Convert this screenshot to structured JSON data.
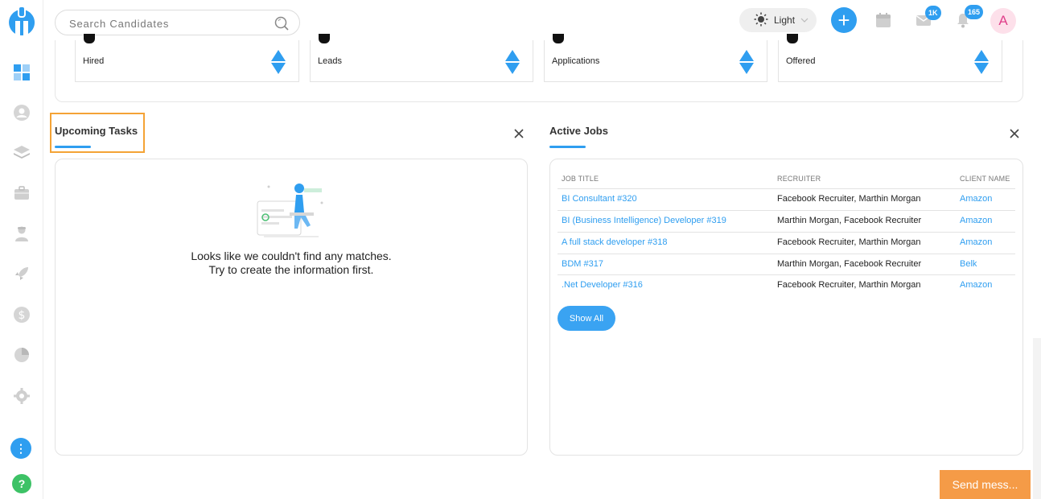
{
  "header": {
    "search_placeholder": "Search Candidates",
    "theme_label": "Light",
    "mail_badge": "1K",
    "notification_badge": "165",
    "avatar_initial": "A"
  },
  "stats": [
    {
      "label": "Hired"
    },
    {
      "label": "Leads"
    },
    {
      "label": "Applications"
    },
    {
      "label": "Offered"
    }
  ],
  "upcoming_tasks": {
    "title": "Upcoming Tasks",
    "empty_line1": "Looks like we couldn't find any matches.",
    "empty_line2": "Try to create the information first."
  },
  "active_jobs": {
    "title": "Active Jobs",
    "columns": [
      "JOB TITLE",
      "RECRUITER",
      "CLIENT NAME"
    ],
    "rows": [
      {
        "title": "BI Consultant #320",
        "recruiter": "Facebook Recruiter, Marthin Morgan",
        "client": "Amazon"
      },
      {
        "title": "BI (Business Intelligence) Developer #319",
        "recruiter": "Marthin Morgan, Facebook Recruiter",
        "client": "Amazon"
      },
      {
        "title": "A full stack developer #318",
        "recruiter": "Facebook Recruiter, Marthin Morgan",
        "client": "Amazon"
      },
      {
        "title": "BDM #317",
        "recruiter": "Marthin Morgan, Facebook Recruiter",
        "client": "Belk"
      },
      {
        "title": ".Net Developer #316",
        "recruiter": "Facebook Recruiter, Marthin Morgan",
        "client": "Amazon"
      }
    ],
    "show_all_label": "Show All"
  },
  "send_message_label": "Send mess...",
  "colors": {
    "accent": "#2f9ef0",
    "highlight": "#f4a336",
    "send_button": "#f59b47",
    "help": "#3dc266"
  },
  "sidebar_icons": [
    "dashboard-icon",
    "candidates-icon",
    "layers-icon",
    "jobs-briefcase-icon",
    "contacts-icon",
    "rocket-icon",
    "dollar-icon",
    "reports-pie-icon",
    "settings-gear-icon",
    "more-dots-icon",
    "help-icon"
  ]
}
